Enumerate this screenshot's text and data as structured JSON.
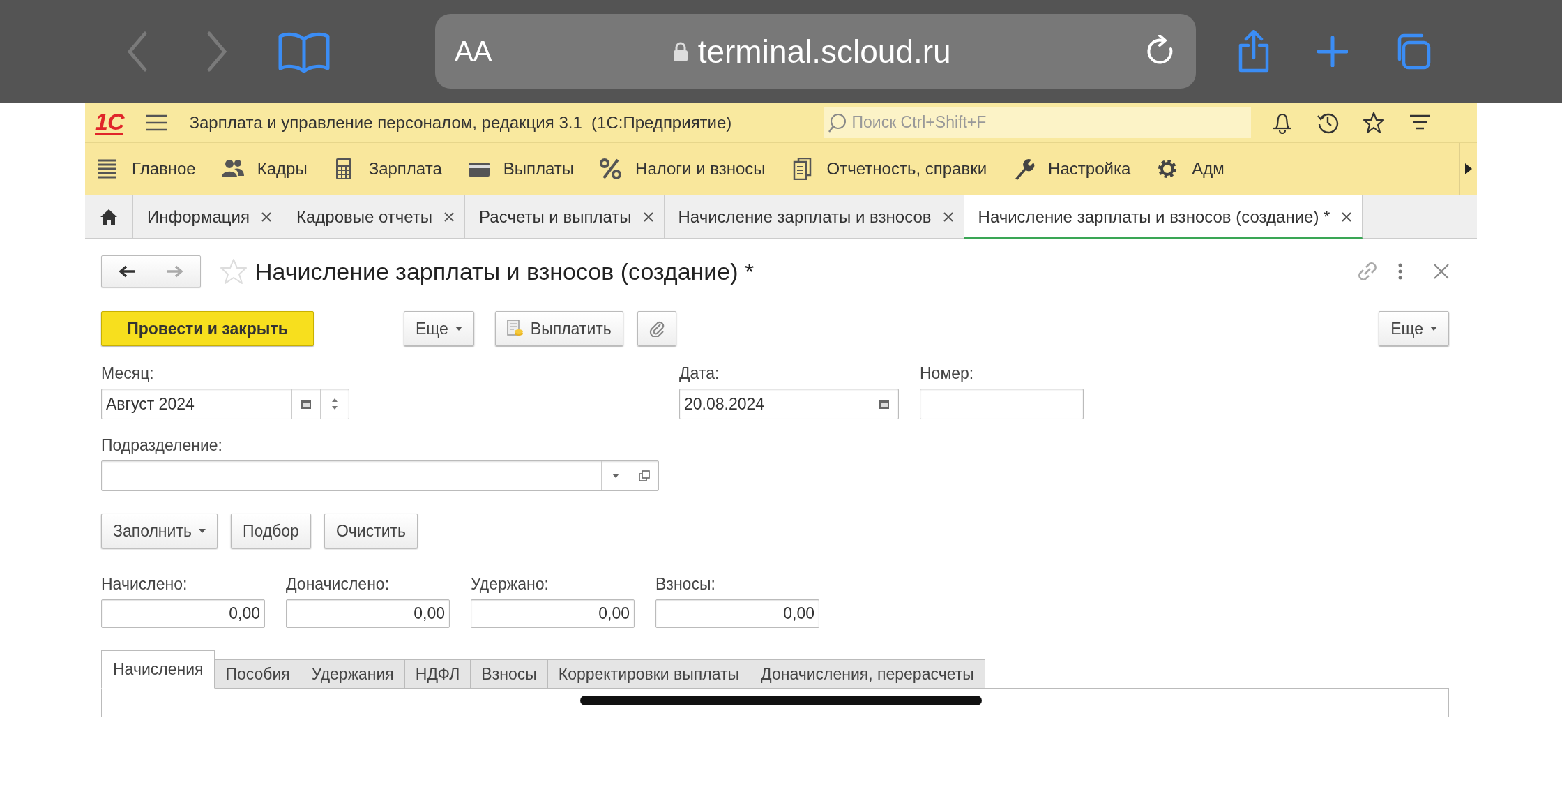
{
  "browser": {
    "reader_label": "AA",
    "url": "terminal.scloud.ru"
  },
  "app": {
    "logo": "1С",
    "title": "Зарплата и управление персоналом, редакция 3.1  (1С:Предприятие)",
    "search": {
      "placeholder": "Поиск Ctrl+Shift+F"
    }
  },
  "sections": [
    {
      "label": "Главное"
    },
    {
      "label": "Кадры"
    },
    {
      "label": "Зарплата"
    },
    {
      "label": "Выплаты"
    },
    {
      "label": "Налоги и взносы"
    },
    {
      "label": "Отчетность, справки"
    },
    {
      "label": "Настройка"
    },
    {
      "label": "Адм"
    }
  ],
  "open_tabs": [
    {
      "label": "Информация",
      "selected": false
    },
    {
      "label": "Кадровые отчеты",
      "selected": false
    },
    {
      "label": "Расчеты и выплаты",
      "selected": false
    },
    {
      "label": "Начисление зарплаты и взносов",
      "selected": false
    },
    {
      "label": "Начисление зарплаты и взносов (создание) *",
      "selected": true
    }
  ],
  "form": {
    "title": "Начисление зарплаты и взносов (создание) *",
    "toolbar": [
      {
        "kind": "primary",
        "label": "Провести и закрыть"
      },
      {
        "kind": "menu",
        "label": "Еще"
      },
      {
        "kind": "pay",
        "label": "Выплатить"
      },
      {
        "kind": "attach"
      }
    ],
    "toolbar_right": {
      "kind": "menu",
      "label": "Еще"
    },
    "month": {
      "label": "Месяц:",
      "value": "Август 2024"
    },
    "date": {
      "label": "Дата:",
      "value": "20.08.2024"
    },
    "number": {
      "label": "Номер:"
    },
    "department": {
      "label": "Подразделение:"
    },
    "fill_buttons": [
      {
        "kind": "menu",
        "label": "Заполнить"
      },
      {
        "kind": "plain",
        "label": "Подбор"
      },
      {
        "kind": "plain",
        "label": "Очистить"
      }
    ],
    "totals": [
      {
        "label": "Начислено:",
        "value": "0,00"
      },
      {
        "label": "Доначислено:",
        "value": "0,00"
      },
      {
        "label": "Удержано:",
        "value": "0,00"
      },
      {
        "label": "Взносы:",
        "value": "0,00"
      }
    ],
    "detail_tabs": [
      {
        "label": "Начисления",
        "selected": true
      },
      {
        "label": "Пособия",
        "selected": false
      },
      {
        "label": "Удержания",
        "selected": false
      },
      {
        "label": "НДФЛ",
        "selected": false
      },
      {
        "label": "Взносы",
        "selected": false
      },
      {
        "label": "Корректировки выплаты",
        "selected": false
      },
      {
        "label": "Доначисления, перерасчеты",
        "selected": false
      }
    ]
  }
}
